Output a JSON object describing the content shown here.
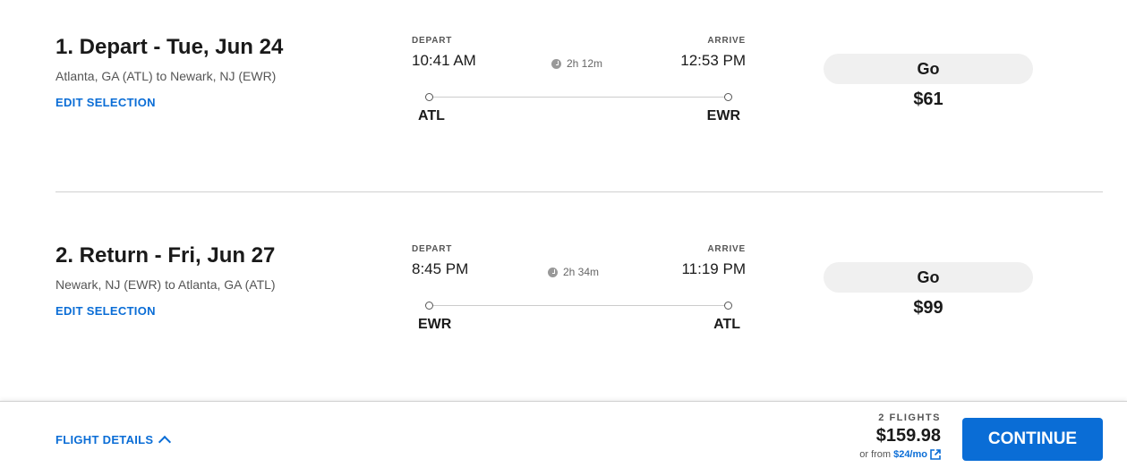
{
  "flights": [
    {
      "title": "1. Depart - Tue, Jun 24",
      "route": "Atlanta, GA (ATL) to Newark, NJ (EWR)",
      "edit_label": "EDIT SELECTION",
      "depart_label": "DEPART",
      "arrive_label": "ARRIVE",
      "depart_time": "10:41 AM",
      "arrive_time": "12:53 PM",
      "duration": "2h 12m",
      "origin_code": "ATL",
      "destination_code": "EWR",
      "fare_label": "Go",
      "price": "$61"
    },
    {
      "title": "2. Return - Fri, Jun 27",
      "route": "Newark, NJ (EWR) to Atlanta, GA (ATL)",
      "edit_label": "EDIT SELECTION",
      "depart_label": "DEPART",
      "arrive_label": "ARRIVE",
      "depart_time": "8:45 PM",
      "arrive_time": "11:19 PM",
      "duration": "2h 34m",
      "origin_code": "EWR",
      "destination_code": "ATL",
      "fare_label": "Go",
      "price": "$99"
    }
  ],
  "footer": {
    "details_label": "FLIGHT DETAILS",
    "flight_count": "2 FLIGHTS",
    "total": "$159.98",
    "monthly_prefix": "or from",
    "monthly_amount": "$24/mo",
    "continue_label": "CONTINUE"
  },
  "colors": {
    "accent": "#0a6dd6",
    "fare_button_bg": "#f0f0f0"
  },
  "icons": {
    "duration": "clock-icon",
    "details_toggle": "chevron-up-icon",
    "monthly_info": "external-link-icon"
  }
}
